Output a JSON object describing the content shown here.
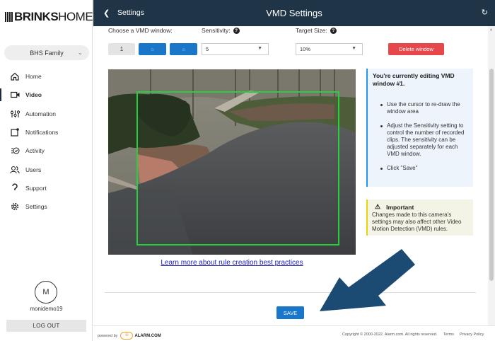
{
  "brand": {
    "logo_bold": "BRINKS",
    "logo_light": "HOME",
    "logo_tm": "™"
  },
  "sidebar": {
    "account": "BHS Family",
    "items": [
      {
        "label": "Home",
        "icon": "home-icon"
      },
      {
        "label": "Video",
        "icon": "video-camera-icon",
        "active": true
      },
      {
        "label": "Automation",
        "icon": "automation-icon"
      },
      {
        "label": "Notifications",
        "icon": "notification-icon"
      },
      {
        "label": "Activity",
        "icon": "activity-icon"
      },
      {
        "label": "Users",
        "icon": "users-icon"
      },
      {
        "label": "Support",
        "icon": "support-icon"
      },
      {
        "label": "Settings",
        "icon": "gear-icon"
      }
    ],
    "avatar_initial": "M",
    "username": "monidemo19",
    "logout": "LOG OUT"
  },
  "header": {
    "back_label": "Settings",
    "title": "VMD Settings"
  },
  "vmd": {
    "choose_label": "Choose a VMD window:",
    "windows": [
      "1",
      "☼",
      "☼"
    ],
    "sensitivity_label": "Sensitivity:",
    "sensitivity_value": "5",
    "target_label": "Target Size:",
    "target_value": "10%",
    "delete_label": "Delete window"
  },
  "info": {
    "title": "You're currently editing VMD window #1.",
    "bullets": [
      "Use the cursor to re-draw the window area",
      "Adjust the Sensitivity setting to control the number of recorded clips. The sensitivity can be adjusted separately for each VMD window.",
      "Click \"Save\""
    ]
  },
  "important": {
    "title": "Important",
    "text": "Changes made to this camera's settings may also affect other Video Motion Detection (VMD) rules."
  },
  "learn_link": "Learn more about rule creation best practices",
  "save_label": "SAVE",
  "footer": {
    "powered": "powered by",
    "alarm": "ALARM.COM",
    "copyright": "Copyright © 2000-2022. Alarm.com. All rights reserved.",
    "terms": "Terms",
    "privacy": "Privacy Policy"
  },
  "colors": {
    "header": "#1f3447",
    "accent": "#1976c9",
    "delete": "#e5474b",
    "vmd_border": "#24d13a",
    "arrow": "#1b4a72"
  }
}
